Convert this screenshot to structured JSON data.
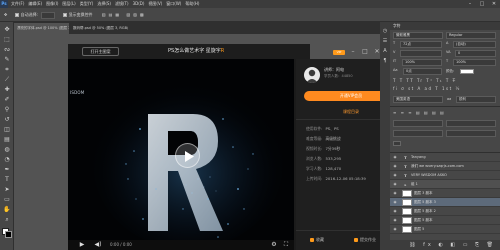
{
  "ps": {
    "menu": [
      "文件(F)",
      "编辑(E)",
      "图像(I)",
      "图层(L)",
      "类型(Y)",
      "选择(S)",
      "滤镜(T)",
      "3D(D)",
      "视图(V)",
      "窗口(W)",
      "帮助(H)"
    ],
    "logo": "Ps",
    "options": {
      "auto_select_label": "自动选择:",
      "auto_select_value": "组",
      "transform_label": "显示变换控件"
    },
    "doc_tabs": [
      "漂亮的字体.psd @ 100% (图层 2, RGB/8)",
      "数码帮.psd @ 50% (图层 3, RGB/8)"
    ],
    "right_panel": {
      "tab": "字符",
      "font": "微软雅黑",
      "style": "Regular",
      "size": "72点",
      "leading": "(自动)",
      "tracking": "0",
      "scale_v": "100%",
      "scale_h": "100%",
      "baseline": "0点",
      "color_label": "颜色:",
      "lang": "美国英语",
      "aa": "锐利"
    },
    "layers": [
      {
        "name": "Tanyang",
        "type": "text",
        "state": "normal"
      },
      {
        "name": "我们 we wvery.szqrjs.com.com",
        "type": "text",
        "state": "normal"
      },
      {
        "name": "VERY WISDOM ASKO",
        "type": "text",
        "state": "normal"
      },
      {
        "name": "组 1",
        "type": "group",
        "state": "group"
      },
      {
        "name": "图层 3 副本",
        "type": "pixel",
        "state": "normal"
      },
      {
        "name": "图层 5 副本 3",
        "type": "pixel",
        "state": "selected"
      },
      {
        "name": "图层 5 副本 2",
        "type": "pixel",
        "state": "normal"
      },
      {
        "name": "图层 5 副本",
        "type": "pixel",
        "state": "normal"
      },
      {
        "name": "图层 5",
        "type": "pixel",
        "state": "normal"
      }
    ]
  },
  "modal": {
    "open_course_label": "打开主图案",
    "title_prefix": "PS怎么做艺术字 星旋字",
    "title_accent": "R",
    "vip_badge": "VIP",
    "video_overlay_text": "ISDOM",
    "player": {
      "time": "0:00 / 0:00"
    }
  },
  "info": {
    "teacher_label": "讲师：阿电",
    "teacher_sub": "学员人数：44850",
    "vip_button": "开通VIP会员",
    "course_link": "课程目录",
    "meta": [
      {
        "label": "使用软件:",
        "value": "PS、PS"
      },
      {
        "label": "难度等级:",
        "value": "高级挑战"
      },
      {
        "label": "视频时长:",
        "value": "7分39秒"
      },
      {
        "label": "浏览人数:",
        "value": "533,295"
      },
      {
        "label": "学习人数:",
        "value": "128,470"
      },
      {
        "label": "上传时间:",
        "value": "2016-12-06 05:18:39"
      }
    ],
    "actions": [
      {
        "label": "收藏"
      },
      {
        "label": "提交作业"
      }
    ]
  },
  "colors": {
    "accent": "#ff8a1f",
    "ps_bg": "#535353",
    "panel": "#474747"
  }
}
